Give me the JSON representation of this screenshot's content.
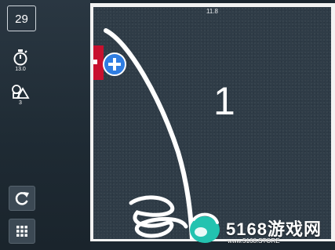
{
  "hud": {
    "level_counter": "29",
    "timer_value": "13.0",
    "shapes_value": "3",
    "elapsed_time": "11.8",
    "level_number": "1"
  },
  "icons": {
    "timer": "stopwatch-icon",
    "shapes": "shapes-icon",
    "restart": "restart-icon",
    "menu": "grid-menu-icon",
    "add": "plus-icon"
  },
  "colors": {
    "board": "#2f3c47",
    "accent_blue": "#2f7de1",
    "accent_red": "#c8102e",
    "watermark_logo": "#23c3b0"
  },
  "watermark": {
    "title": "5168游戏网",
    "url": "www.5168.STORE"
  }
}
